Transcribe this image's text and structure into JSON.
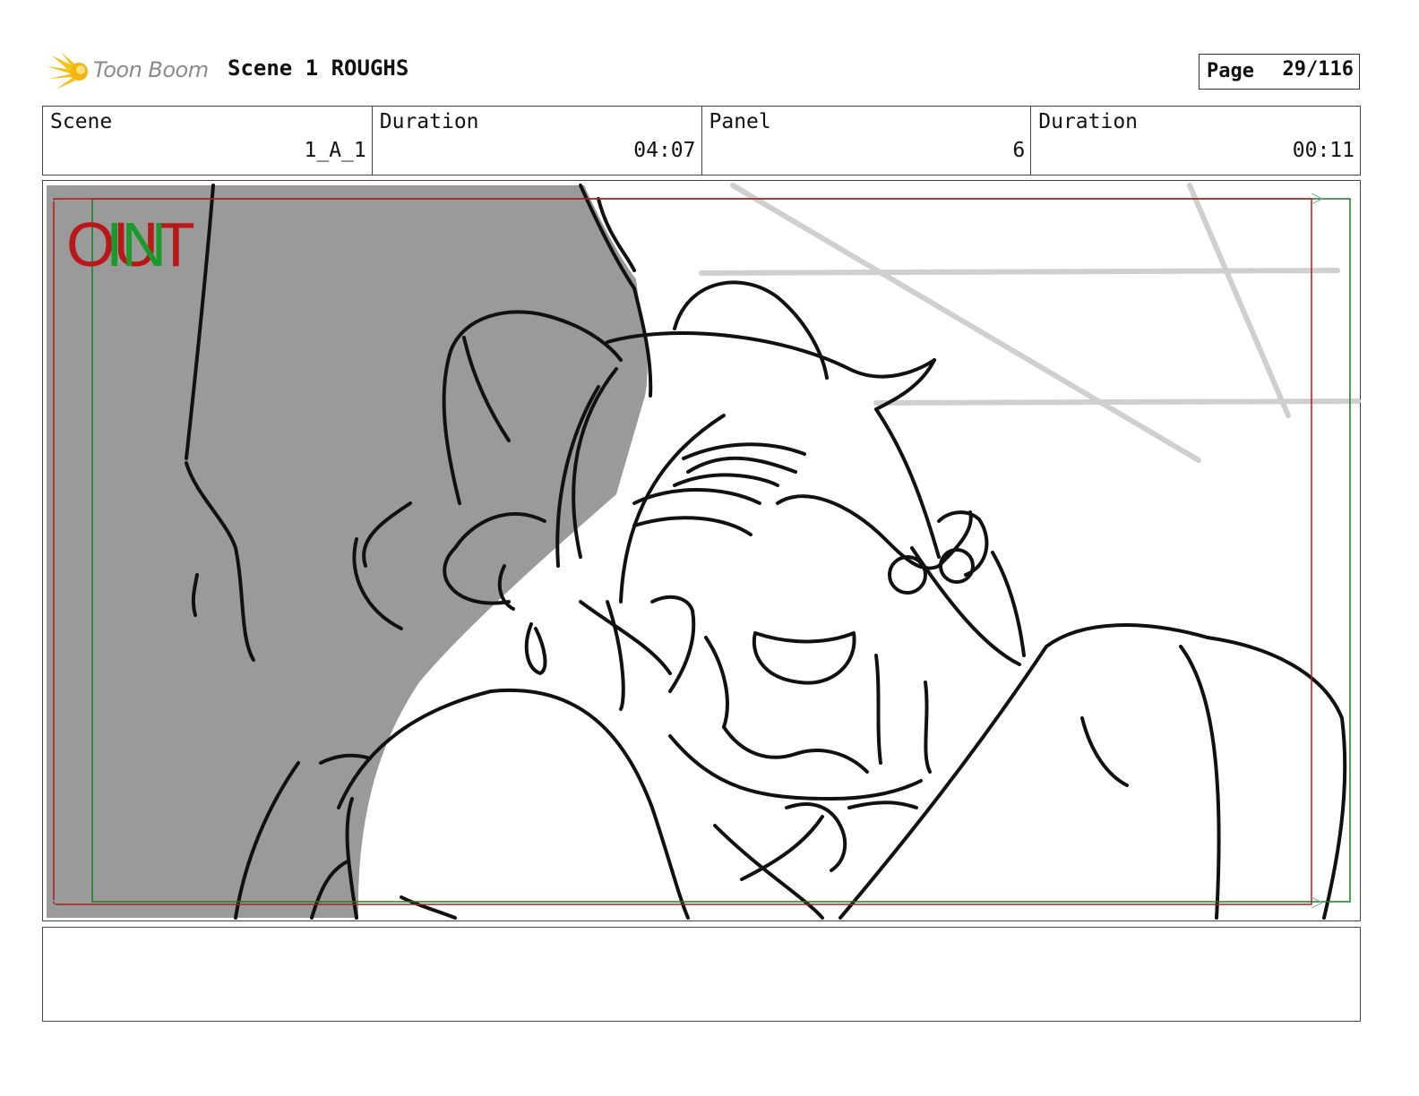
{
  "header": {
    "logo_text": "Toon Boom",
    "title": "Scene 1 ROUGHS",
    "page_label": "Page",
    "page_value": "29/116"
  },
  "info": {
    "scene_label": "Scene",
    "scene_value": "1_A_1",
    "duration_label": "Duration",
    "duration_value": "04:07",
    "panel_label": "Panel",
    "panel_value": "6",
    "panel_duration_label": "Duration",
    "panel_duration_value": "00:11"
  },
  "panel": {
    "out_label": "OUT",
    "in_label": "IN",
    "colors": {
      "out": "#b81818",
      "in": "#1a9a2a",
      "shadow": "#9a9a9a"
    }
  },
  "notes": {
    "text": ""
  }
}
